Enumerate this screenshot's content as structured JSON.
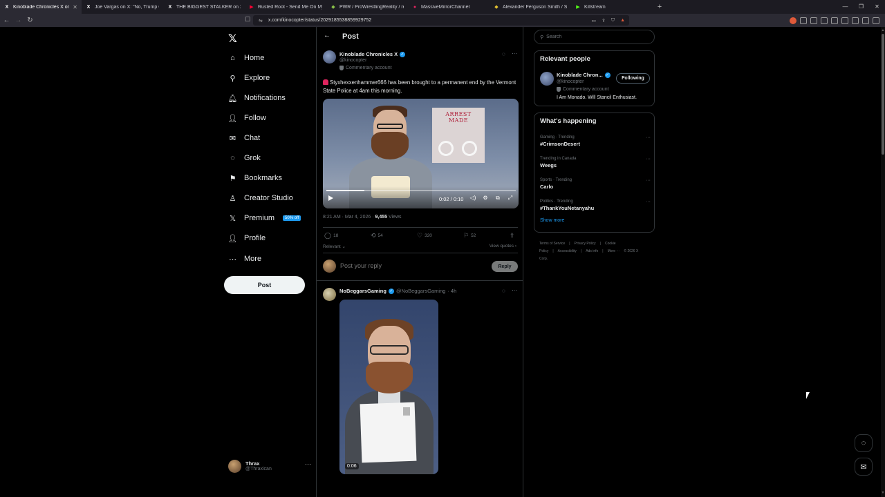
{
  "browser": {
    "tabs": [
      {
        "title": "Kinoblade Chronicles X on X: \"",
        "fav": "X",
        "favColor": "#2b2a33",
        "active": true
      },
      {
        "title": "Joe Vargas on X: \"No, Trump CANNO",
        "fav": "X",
        "favColor": "#1c1b22",
        "active": false
      },
      {
        "title": "THE BIGGEST STALKER on X: \"COG H",
        "fav": "X",
        "favColor": "#1c1b22",
        "active": false
      },
      {
        "title": "Rusted Root - Send Me On My Way |",
        "fav": "▶",
        "favColor": "#ff0033",
        "active": false
      },
      {
        "title": "PWR / ProWrestlingReality / realpers",
        "fav": "◆",
        "favColor": "#8bc34a",
        "active": false
      },
      {
        "title": "MassiveMirrorChannel",
        "fav": "●",
        "favColor": "#e0245e",
        "active": false
      },
      {
        "title": "Alexander Ferguson Smith / Sifu / Sif",
        "fav": "◆",
        "favColor": "#e0c030",
        "active": false
      },
      {
        "title": "Killstream",
        "fav": "▶",
        "favColor": "#53fc18",
        "active": false
      }
    ],
    "url": "x.com/kinocopter/status/2029185538859929752"
  },
  "sidebar": {
    "items": [
      {
        "label": "Home",
        "icon": "⌂",
        "name": "home"
      },
      {
        "label": "Explore",
        "icon": "⚲",
        "name": "explore"
      },
      {
        "label": "Notifications",
        "icon": "🔔︎",
        "name": "notifications"
      },
      {
        "label": "Follow",
        "icon": "👤︎",
        "name": "follow"
      },
      {
        "label": "Chat",
        "icon": "✉",
        "name": "chat"
      },
      {
        "label": "Grok",
        "icon": "◌",
        "name": "grok"
      },
      {
        "label": "Bookmarks",
        "icon": "⚑",
        "name": "bookmarks"
      },
      {
        "label": "Creator Studio",
        "icon": "♙",
        "name": "creator-studio"
      },
      {
        "label": "Premium",
        "icon": "𝕏",
        "name": "premium"
      },
      {
        "label": "Profile",
        "icon": "👤︎",
        "name": "profile"
      },
      {
        "label": "More",
        "icon": "⋯",
        "name": "more"
      }
    ],
    "premium_badge": "50% off",
    "post_label": "Post",
    "account": {
      "name": "Thrax",
      "handle": "@Thraxican"
    }
  },
  "main": {
    "header": "Post",
    "post": {
      "author": "Kinoblade Chronicles X",
      "handle": "@kinocopter",
      "commentary": "Commentary account",
      "text": "Styxhexxenhammer666 has been brought to a permanent end by the Vermont State Police at 4am this morning.",
      "video": {
        "card_line1": "ARREST",
        "card_line2": "MADE",
        "time": "0:02 / 0:10",
        "progress": 0.2
      },
      "timestamp": "8:21 AM · Mar 4, 2026 · ",
      "views_count": "9,455",
      "views_label": " Views",
      "replies": "18",
      "reposts": "54",
      "likes": "320",
      "bookmarks": "52",
      "relevant": "Relevant",
      "view_quotes": "View quotes"
    },
    "reply_box": {
      "placeholder": "Post your reply",
      "button": "Reply"
    },
    "reply": {
      "author": "NoBeggarsGaming",
      "handle": "@NoBeggarsGaming",
      "time": "· 4h",
      "video_time": "0:06"
    }
  },
  "right": {
    "search_placeholder": "Search",
    "relevant_people": {
      "title": "Relevant people",
      "name": "Kinoblade Chron...",
      "handle": "@kinocopter",
      "commentary": "Commentary account",
      "bio": "I Am Monado. Will Stancil Enthusiast.",
      "button": "Following"
    },
    "whats_happening": {
      "title": "What's happening",
      "trends": [
        {
          "category": "Gaming · Trending",
          "name": "#CrimsonDesert"
        },
        {
          "category": "Trending in Canada",
          "name": "Weegs"
        },
        {
          "category": "Sports · Trending",
          "name": "Carlo"
        },
        {
          "category": "Politics · Trending",
          "name": "#ThankYouNetanyahu"
        }
      ],
      "show_more": "Show more"
    },
    "footer": [
      "Terms of Service",
      "|",
      "Privacy Policy",
      "|",
      "Cookie Policy",
      "|",
      "Accessibility",
      "|",
      "Ads info",
      "|",
      "More ···",
      "© 2026 X Corp."
    ]
  }
}
